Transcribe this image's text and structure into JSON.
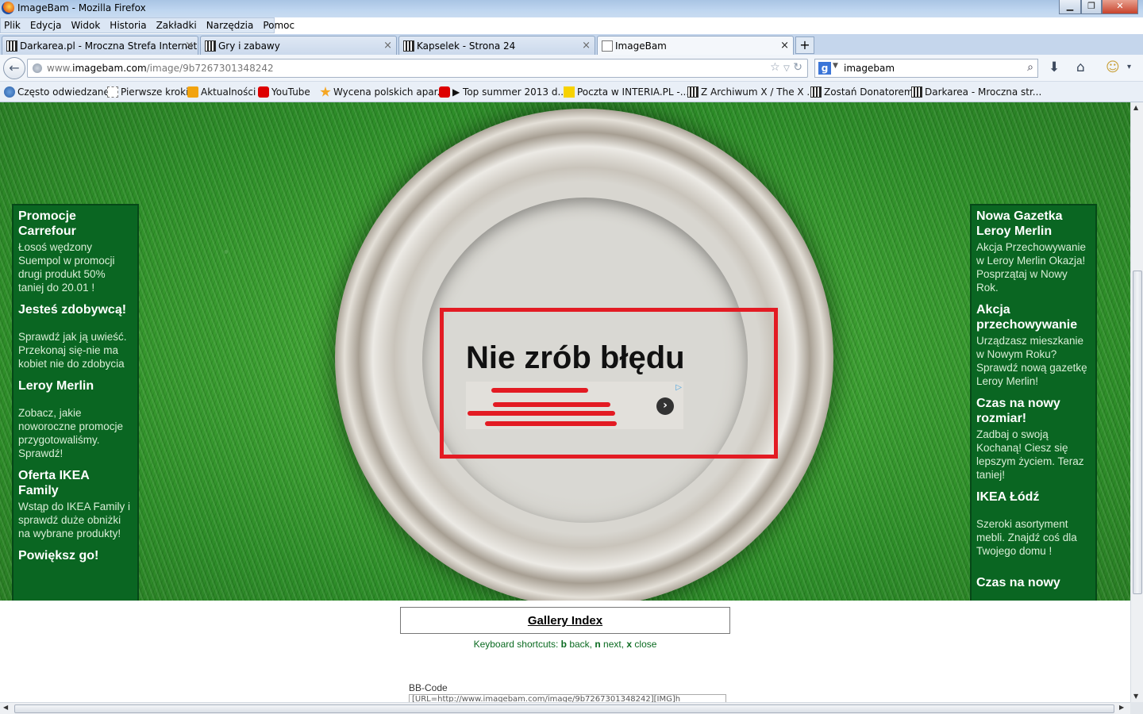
{
  "window": {
    "title": "ImageBam - Mozilla Firefox"
  },
  "menu": [
    "Plik",
    "Edycja",
    "Widok",
    "Historia",
    "Zakładki",
    "Narzędzia",
    "Pomoc"
  ],
  "tabs": [
    {
      "label": "Darkarea.pl - Mroczna Strefa Internetu",
      "icon": "darkarea-icon"
    },
    {
      "label": "Gry i zabawy",
      "icon": "darkarea-icon"
    },
    {
      "label": "Kapselek - Strona 24",
      "icon": "darkarea-icon"
    },
    {
      "label": "ImageBam",
      "icon": "page-icon",
      "active": true
    }
  ],
  "new_tab": "+",
  "url": {
    "prefix": "www.",
    "host": "imagebam.com",
    "path": "/image/9b7267301348242"
  },
  "search": {
    "engine": "g",
    "query": "imagebam"
  },
  "bookmarks": [
    {
      "label": "Często odwiedzane",
      "icon": "help-icon"
    },
    {
      "label": "Pierwsze kroki",
      "icon": "page-icon"
    },
    {
      "label": "Aktualności",
      "icon": "rss-icon"
    },
    {
      "label": "YouTube",
      "icon": "youtube-icon"
    },
    {
      "label": "Wycena polskich apar...",
      "icon": "star-icon"
    },
    {
      "label": "▶ Top summer 2013 d...",
      "icon": "youtube-icon"
    },
    {
      "label": "Poczta w INTERIA.PL -...",
      "icon": "interia-icon"
    },
    {
      "label": "Z Archiwum X / The X ...",
      "icon": "darkarea-icon"
    },
    {
      "label": "Zostań Donatorem",
      "icon": "darkarea-icon"
    },
    {
      "label": "Darkarea - Mroczna str...",
      "icon": "darkarea-icon"
    }
  ],
  "left_ads": [
    {
      "title": "Promocje Carrefour",
      "text": "Łosoś wędzony Suempol w promocji drugi produkt 50% taniej do 20.01 !"
    },
    {
      "title": "Jesteś zdobywcą!",
      "text": "Sprawdź jak ją uwieść. Przekonaj się-nie ma kobiet nie do zdobycia"
    },
    {
      "title": "Leroy Merlin",
      "text": "Zobacz, jakie noworoczne promocje przygotowaliśmy. Sprawdź!"
    },
    {
      "title": "Oferta IKEA Family",
      "text": "Wstąp do IKEA Family i sprawdź duże obniżki na wybrane produkty!"
    },
    {
      "title": "Powiększ go!",
      "text": ""
    }
  ],
  "right_ads": [
    {
      "title": "Nowa Gazetka Leroy Merlin",
      "text": "Akcja Przechowywanie w Leroy Merlin Okazja! Posprzątaj w Nowy Rok."
    },
    {
      "title": "Akcja przechowywanie",
      "text": "Urządzasz mieszkanie w Nowym Roku? Sprawdź nową gazetkę Leroy Merlin!"
    },
    {
      "title": "Czas na nowy rozmiar!",
      "text": "Zadbaj o swoją Kochaną! Ciesz się lepszym życiem. Teraz taniej!"
    },
    {
      "title": "IKEA Łódź",
      "text": "Szeroki asortyment mebli. Znajdź coś dla Twojego domu !"
    },
    {
      "title": "Czas na nowy",
      "text": ""
    }
  ],
  "annotation": {
    "headline": "Nie zrób błędu",
    "adchoices": "▷",
    "arrow": "›"
  },
  "gallery_index": "Gallery Index",
  "shortcuts": {
    "prefix": "Keyboard shortcuts: ",
    "k1": "b",
    "t1": " back, ",
    "k2": "n",
    "t2": " next, ",
    "k3": "x",
    "t3": " close"
  },
  "bbcode": {
    "label": "BB-Code",
    "value": "[URL=http://www.imagebam.com/image/9b7267301348242][IMG]h"
  },
  "colors": {
    "accent_red": "#e31b23",
    "ad_green": "#0a6622",
    "shortcut_green": "#0a6a20"
  }
}
